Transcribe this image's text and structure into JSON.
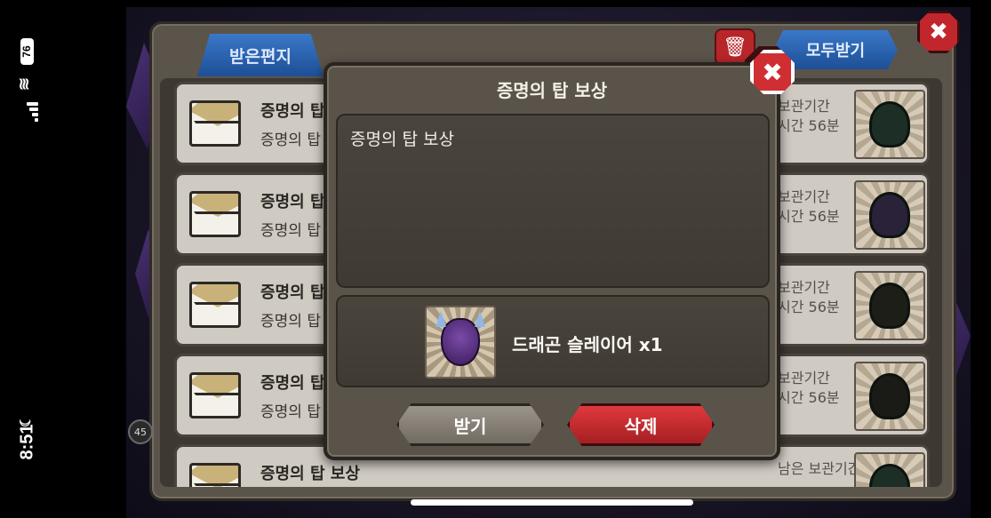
{
  "status_bar": {
    "battery": "76",
    "time": "8:51"
  },
  "mailbox": {
    "tab_received": "받은편지",
    "receive_all": "모두받기",
    "rows": [
      {
        "title": "증명의 탑",
        "subtitle": "증명의 탑",
        "keep_line1": "보관기간",
        "keep_line2": "시간 56분"
      },
      {
        "title": "증명의 탑",
        "subtitle": "증명의 탑",
        "keep_line1": "보관기간",
        "keep_line2": "시간 56분"
      },
      {
        "title": "증명의 탑",
        "subtitle": "증명의 탑",
        "keep_line1": "보관기간",
        "keep_line2": "시간 56분"
      },
      {
        "title": "증명의 탑",
        "subtitle": "증명의 탑",
        "keep_line1": "보관기간",
        "keep_line2": "시간 56분"
      },
      {
        "title": "증명의 탑 보상",
        "subtitle": "",
        "keep_line1": "남은 보관기간",
        "keep_line2": ""
      }
    ],
    "left_badge": "45"
  },
  "reward_modal": {
    "title": "증명의 탑 보상",
    "message": "증명의 탑 보상",
    "reward_label": "드래곤 슬레이어 x1",
    "receive_button": "받기",
    "delete_button": "삭제"
  }
}
